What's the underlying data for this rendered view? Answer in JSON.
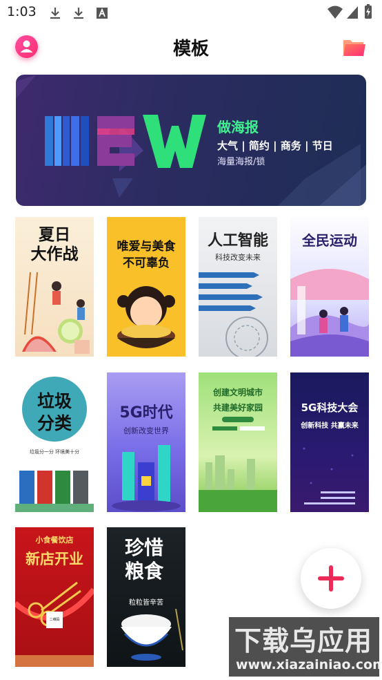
{
  "status_bar": {
    "time": "1:03"
  },
  "header": {
    "title": "模板"
  },
  "banner": {
    "logo_text": "NEW",
    "heading": "做海报",
    "tags": "大气 | 简约 | 商务 | 节日",
    "tagline": "海量海报/锁"
  },
  "templates": [
    {
      "title_line1": "夏日",
      "title_line2": "大作战"
    },
    {
      "title_line1": "唯爱与美食",
      "title_line2": "不可辜负"
    },
    {
      "title": "人工智能",
      "subtitle": "科技改变未来"
    },
    {
      "title": "全民运动"
    },
    {
      "title_line1": "垃圾",
      "title_line2": "分类",
      "subtitle": "垃圾分一分 环境美十分"
    },
    {
      "title": "5G时代",
      "subtitle": "创新改变世界"
    },
    {
      "title_line1": "创建文明城市",
      "title_line2": "共建美好家园"
    },
    {
      "title": "5G科技大会",
      "subtitle": "创新科技 共赢未来"
    },
    {
      "brand": "小食餐饮店",
      "title": "新店开业",
      "qr_label": "二维码"
    },
    {
      "title_line1": "珍惜",
      "title_line2": "粮食",
      "subtitle": "粒粒皆辛苦"
    }
  ],
  "fab": {
    "icon": "plus-icon"
  },
  "watermark": {
    "line1": "下载乌应用",
    "line2": "www.xiazainiao.com"
  }
}
